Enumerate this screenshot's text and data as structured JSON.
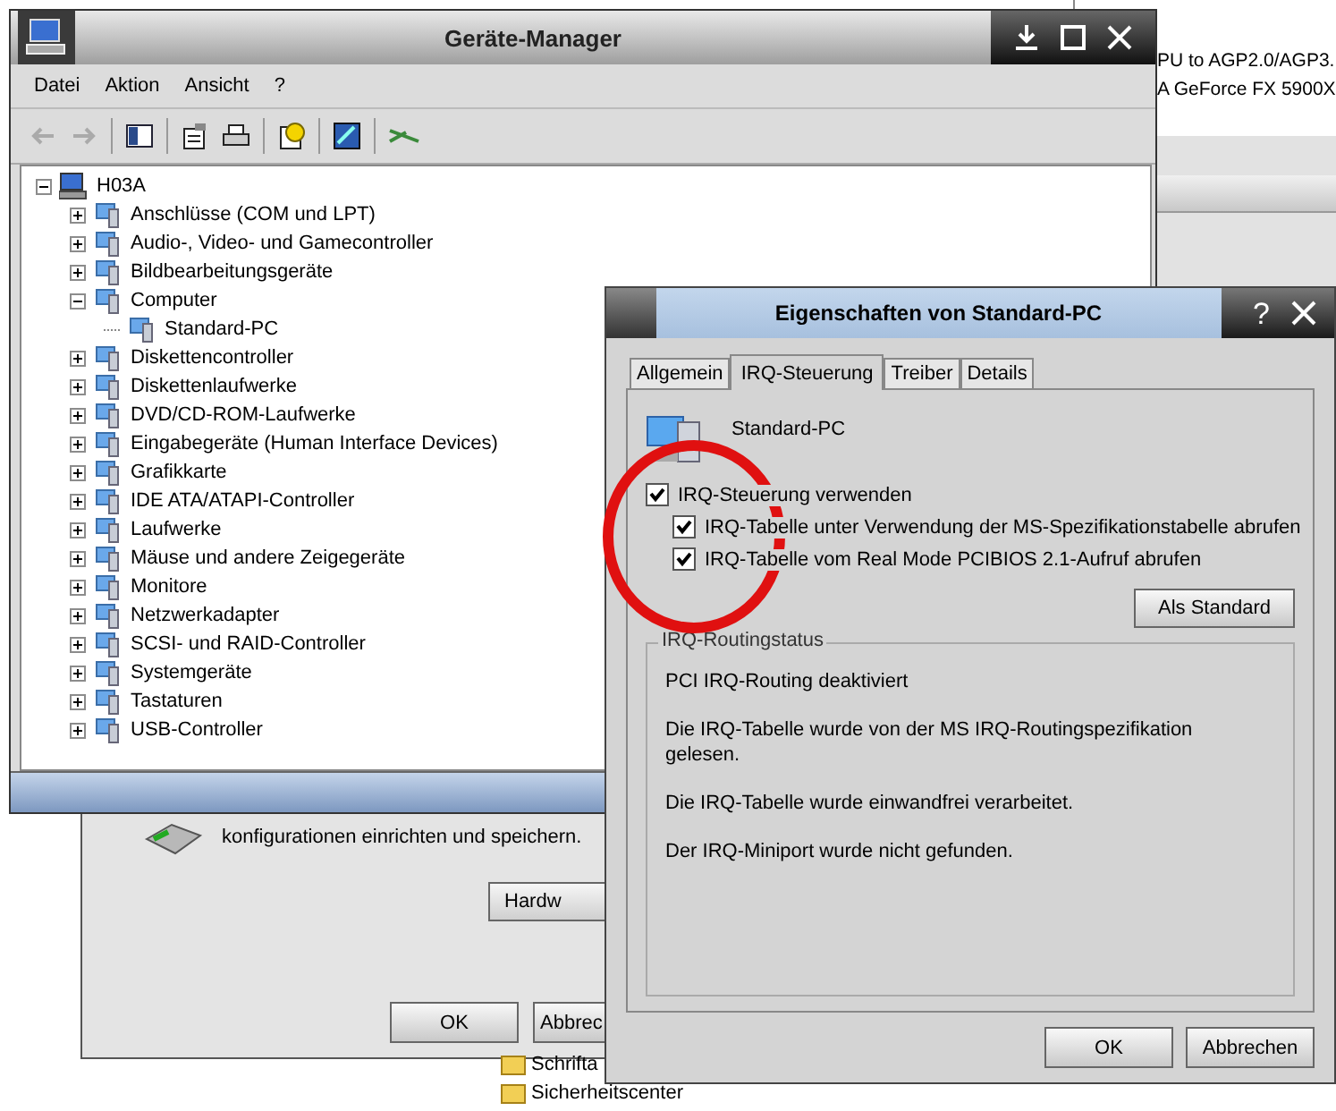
{
  "background_window": {
    "lines": [
      "PU to AGP2.0/AGP3.",
      "A GeForce FX 5900X"
    ]
  },
  "background_dialog": {
    "description": "konfigurationen einrichten und speichern.",
    "hardware_button": "Hardw",
    "buttons": [
      "OK",
      "Abbrec"
    ]
  },
  "background_list": [
    {
      "label": "Schrifta"
    },
    {
      "label": "Sicherheitscenter"
    }
  ],
  "device_manager": {
    "title": "Geräte-Manager",
    "menu": [
      "Datei",
      "Aktion",
      "Ansicht",
      "?"
    ],
    "tree": {
      "label": "H03A",
      "expanded": true,
      "children": [
        {
          "label": "Anschlüsse (COM und LPT)",
          "expanded": false
        },
        {
          "label": "Audio-, Video- und Gamecontroller",
          "expanded": false
        },
        {
          "label": "Bildbearbeitungsgeräte",
          "expanded": false
        },
        {
          "label": "Computer",
          "expanded": true,
          "children": [
            {
              "label": "Standard-PC"
            }
          ]
        },
        {
          "label": "Diskettencontroller",
          "expanded": false
        },
        {
          "label": "Diskettenlaufwerke",
          "expanded": false
        },
        {
          "label": "DVD/CD-ROM-Laufwerke",
          "expanded": false
        },
        {
          "label": "Eingabegeräte (Human Interface Devices)",
          "expanded": false
        },
        {
          "label": "Grafikkarte",
          "expanded": false
        },
        {
          "label": "IDE ATA/ATAPI-Controller",
          "expanded": false
        },
        {
          "label": "Laufwerke",
          "expanded": false
        },
        {
          "label": "Mäuse und andere Zeigegeräte",
          "expanded": false
        },
        {
          "label": "Monitore",
          "expanded": false
        },
        {
          "label": "Netzwerkadapter",
          "expanded": false
        },
        {
          "label": "SCSI- und RAID-Controller",
          "expanded": false
        },
        {
          "label": "Systemgeräte",
          "expanded": false
        },
        {
          "label": "Tastaturen",
          "expanded": false
        },
        {
          "label": "USB-Controller",
          "expanded": false
        }
      ]
    }
  },
  "properties_dialog": {
    "title": "Eigenschaften von Standard-PC",
    "help": "?",
    "tabs": [
      {
        "label": "Allgemein",
        "selected": false
      },
      {
        "label": "IRQ-Steuerung",
        "selected": true
      },
      {
        "label": "Treiber",
        "selected": false
      },
      {
        "label": "Details",
        "selected": false
      }
    ],
    "device_name": "Standard-PC",
    "options": [
      {
        "label": "IRQ-Steuerung verwenden",
        "checked": true,
        "children": [
          {
            "label": "IRQ-Tabelle unter Verwendung der MS-Spezifikationstabelle abrufen",
            "checked": true
          },
          {
            "label": "IRQ-Tabelle vom Real Mode PCIBIOS 2.1-Aufruf abrufen",
            "checked": true
          }
        ]
      }
    ],
    "default_button": "Als Standard",
    "status_group": {
      "title": "IRQ-Routingstatus",
      "lines": [
        "PCI IRQ-Routing deaktiviert",
        "Die IRQ-Tabelle wurde von der MS IRQ-Routingspezifikation gelesen.",
        "Die IRQ-Tabelle wurde einwandfrei verarbeitet.",
        "Der IRQ-Miniport wurde nicht gefunden."
      ]
    },
    "buttons": [
      "OK",
      "Abbrechen"
    ]
  }
}
